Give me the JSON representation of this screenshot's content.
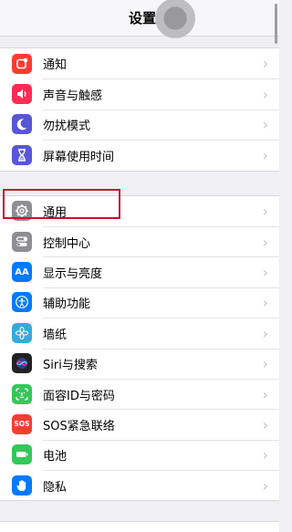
{
  "nav": {
    "title": "设置"
  },
  "groups": [
    [
      {
        "name": "notifications",
        "label": "通知",
        "color": "#ff3b30",
        "icon": "notifications-icon"
      },
      {
        "name": "sounds",
        "label": "声音与触感",
        "color": "#ff2d55",
        "icon": "speaker-icon"
      },
      {
        "name": "do-not-disturb",
        "label": "勿扰模式",
        "color": "#5856d6",
        "icon": "moon-icon"
      },
      {
        "name": "screen-time",
        "label": "屏幕使用时间",
        "color": "#5856d6",
        "icon": "hourglass-icon"
      }
    ],
    [
      {
        "name": "general",
        "label": "通用",
        "color": "#8e8e93",
        "icon": "gear-icon"
      },
      {
        "name": "control-center",
        "label": "控制中心",
        "color": "#8e8e93",
        "icon": "toggles-icon"
      },
      {
        "name": "display-brightness",
        "label": "显示与亮度",
        "color": "#007aff",
        "icon": "text-size-icon"
      },
      {
        "name": "accessibility",
        "label": "辅助功能",
        "color": "#007aff",
        "icon": "accessibility-icon"
      },
      {
        "name": "wallpaper",
        "label": "墙纸",
        "color": "#34aadc",
        "icon": "flower-icon"
      },
      {
        "name": "siri-search",
        "label": "Siri与搜索",
        "color": "#222222",
        "icon": "siri-icon"
      },
      {
        "name": "face-id",
        "label": "面容ID与密码",
        "color": "#34c759",
        "icon": "face-id-icon"
      },
      {
        "name": "emergency-sos",
        "label": "SOS紧急联络",
        "color": "#ff3b30",
        "icon": "sos-icon"
      },
      {
        "name": "battery",
        "label": "电池",
        "color": "#34c759",
        "icon": "battery-icon"
      },
      {
        "name": "privacy",
        "label": "隐私",
        "color": "#007aff",
        "icon": "hand-icon"
      }
    ]
  ],
  "chevron": "›",
  "sos_text": "SOS",
  "aa_text": "AA"
}
